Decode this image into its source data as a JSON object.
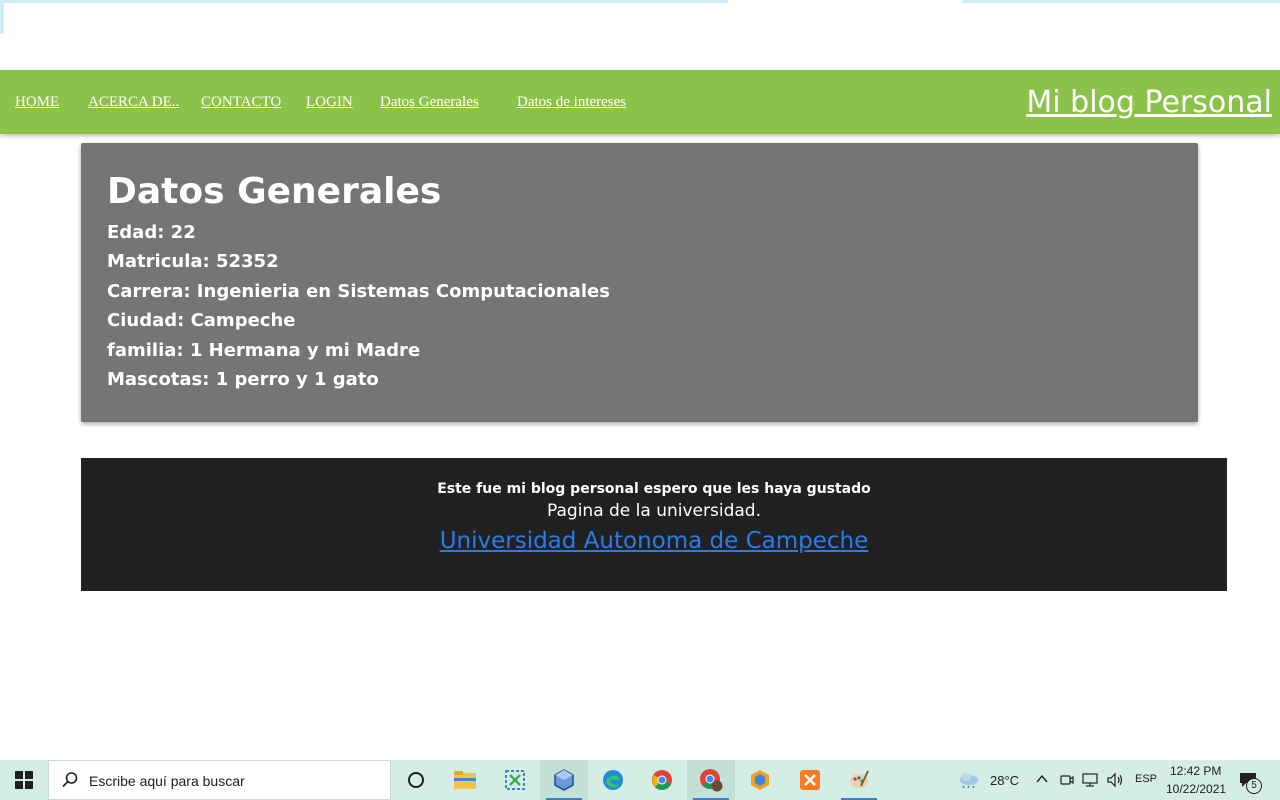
{
  "nav": {
    "links": [
      "HOME",
      "ACERCA DE..",
      "CONTACTO",
      "LOGIN",
      "Datos Generales",
      "Datos de intereses"
    ],
    "brand": "Mi blog Personal",
    "bg_color": "#8bc34a"
  },
  "card": {
    "title": "Datos Generales",
    "lines": [
      "Edad: 22",
      "Matricula: 52352",
      "Carrera: Ingenieria en Sistemas Computacionales",
      "Ciudad: Campeche",
      "familia: 1 Hermana y mi Madre",
      "Mascotas: 1 perro y 1 gato"
    ],
    "bg_color": "#757575"
  },
  "footer": {
    "message": "Este fue mi blog personal espero que les haya gustado",
    "subtitle": "Pagina de la universidad.",
    "link": "Universidad Autonoma de Campeche",
    "link_color": "#2a7ce8"
  },
  "taskbar": {
    "search_placeholder": "Escribe aquí para buscar",
    "apps": [
      "cortana-icon",
      "file-explorer-icon",
      "snip-tool-icon",
      "virtualbox-icon",
      "edge-icon",
      "chrome-icon",
      "chrome-profile-icon",
      "netbeans-icon",
      "xampp-icon",
      "paint-icon"
    ],
    "weather": "28°C",
    "language": "ESP",
    "time": "12:42 PM",
    "date": "10/22/2021",
    "notification_count": "5"
  }
}
